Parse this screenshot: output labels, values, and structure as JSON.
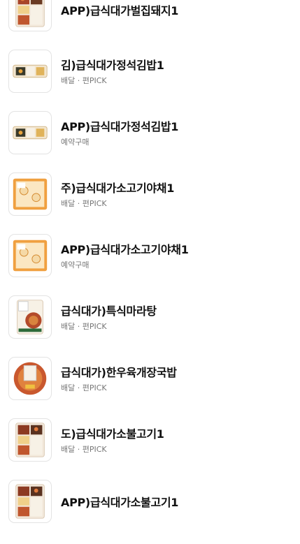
{
  "colors": {
    "title": "#111111",
    "subtitle": "#777777",
    "thumb_border": "#e3e3e3"
  },
  "products": [
    {
      "title": "APP)급식대가벌집돼지1",
      "subtitle": "",
      "thumb": "lunchbox-icon"
    },
    {
      "title": "김)급식대가정석김밥1",
      "subtitle": "배달 · 편PICK",
      "thumb": "gimbap-icon"
    },
    {
      "title": "APP)급식대가정석김밥1",
      "subtitle": "예약구매",
      "thumb": "gimbap-icon"
    },
    {
      "title": "주)급식대가소고기야채1",
      "subtitle": "배달 · 편PICK",
      "thumb": "rice-ball-icon"
    },
    {
      "title": "APP)급식대가소고기야채1",
      "subtitle": "예약구매",
      "thumb": "rice-ball-icon"
    },
    {
      "title": "급식대가)특식마라탕",
      "subtitle": "배달 · 편PICK",
      "thumb": "soup-pack-icon"
    },
    {
      "title": "급식대가)한우육개장국밥",
      "subtitle": "배달 · 편PICK",
      "thumb": "soup-bowl-icon"
    },
    {
      "title": "도)급식대가소불고기1",
      "subtitle": "배달 · 편PICK",
      "thumb": "lunchbox-icon"
    },
    {
      "title": "APP)급식대가소불고기1",
      "subtitle": "",
      "thumb": "lunchbox-icon"
    }
  ]
}
